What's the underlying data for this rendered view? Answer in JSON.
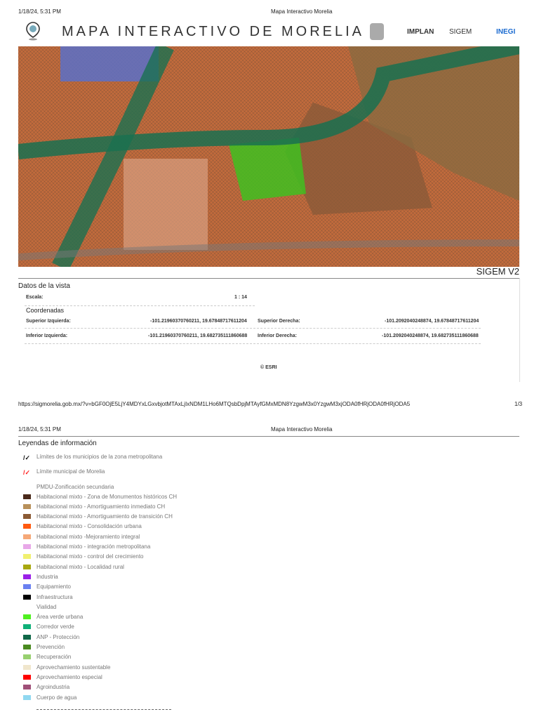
{
  "page1": {
    "datetime": "1/18/24, 5:31 PM",
    "doc_title": "Mapa Interactivo Morelia",
    "page_num": "1/3",
    "url": "https://sigmorelia.gob.mx/?v=bGF0OjE5LjY4MDYxLGxvbjotMTAxLjIxNDM1LHo6MTQsbDpjMTAyfGMxMDN8YzgwM3x0YzgwM3xjODA0fHRjODA0fHRjODA5"
  },
  "header": {
    "title": "MAPA INTERACTIVO DE MORELIA",
    "logos": [
      "IMPLAN",
      "SIGEM",
      "INEGI"
    ]
  },
  "map": {
    "version_label": "SIGEM V2",
    "attribution": "© ESRI"
  },
  "view_data": {
    "title": "Datos de la vista",
    "scale_label": "Escala:",
    "scale_value": "1 : 14",
    "coords_title": "Coordenadas",
    "upper_left_label": "Superior Izquierda:",
    "upper_left": "-101.21960370760211, 19.67848717611204",
    "upper_right_label": "Superior Derecha:",
    "upper_right": "-101.2092040248874, 19.67848717611204",
    "lower_left_label": "Inferior Izquierda:",
    "lower_left": "-101.21960370760211, 19.682735111860688",
    "lower_right_label": "Inferior Derecha:",
    "lower_right": "-101.2092040248874, 19.682735111860688"
  },
  "page2": {
    "datetime": "1/18/24, 5:31 PM",
    "doc_title": "Mapa Interactivo Morelia"
  },
  "legend": {
    "title": "Leyendas de información",
    "lines": [
      {
        "label": "Límites de los municipios de la zona metropolitana",
        "color": "#111111"
      },
      {
        "label": "Límite municipal de Morelia",
        "color": "#ff2020"
      }
    ],
    "group": "PMDU-Zonificación secundaria",
    "items": [
      {
        "label": "Habitacional mixto - Zona de Monumentos históricos CH",
        "color": "#4a2a1a"
      },
      {
        "label": "Habitacional mixto - Amortiguamiento inmediato CH",
        "color": "#b8905a"
      },
      {
        "label": "Habitacional mixto - Amortiguamiento de transición CH",
        "color": "#8b5a34"
      },
      {
        "label": "Habitacional mixto - Consolidación urbana",
        "color": "#ff5a10"
      },
      {
        "label": "Habitacional mixto -Mejoramiento integral",
        "color": "#f5a878"
      },
      {
        "label": "Habitacional mixto - integración metropolitana",
        "color": "#e8a8e8"
      },
      {
        "label": "Habitacional mixto - control del crecimiento",
        "color": "#f0f070"
      },
      {
        "label": "Habitacional mixto - Localidad rural",
        "color": "#a8a810"
      },
      {
        "label": "Industria",
        "color": "#9a20e8"
      },
      {
        "label": "Equipamiento",
        "color": "#6a80f0"
      },
      {
        "label": "Infraestructura",
        "color": "#000000"
      },
      {
        "label": "Vialidad",
        "color": "#ffffff"
      },
      {
        "label": "Área verde urbana",
        "color": "#50f020"
      },
      {
        "label": "Corredor verde",
        "color": "#10b078"
      },
      {
        "label": "ANP - Protección",
        "color": "#106848"
      },
      {
        "label": "Prevención",
        "color": "#4a8a20"
      },
      {
        "label": "Recuperación",
        "color": "#98d070"
      },
      {
        "label": "Aprovechamiento sustentable",
        "color": "#f0e6cc"
      },
      {
        "label": "Aprovechamiento especial",
        "color": "#ff0000"
      },
      {
        "label": "Agroindustria",
        "color": "#a05078"
      },
      {
        "label": "Cuerpo de agua",
        "color": "#90d8f0"
      }
    ]
  }
}
